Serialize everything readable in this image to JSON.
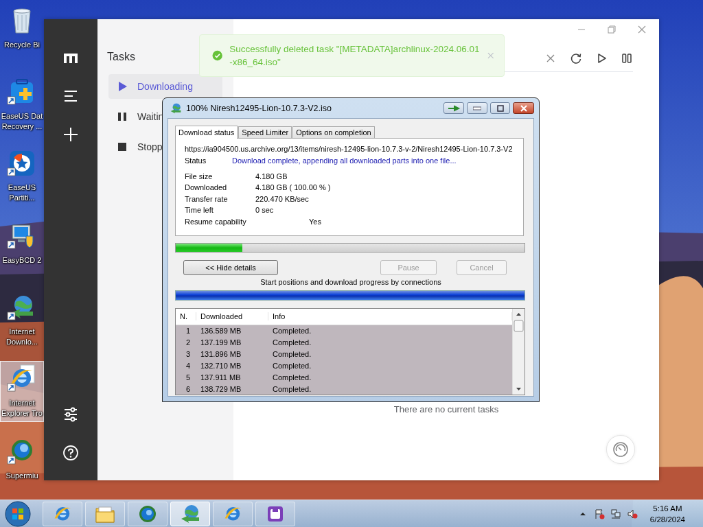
{
  "desktop": {
    "kind": "picture",
    "icons": [
      {
        "lines": [
          "Recycle Bi"
        ],
        "selected": false
      },
      {
        "lines": [
          "EaseUS Dat",
          "Recovery ..."
        ],
        "selected": false
      },
      {
        "lines": [
          "EaseUS",
          "Partiti..."
        ],
        "selected": false
      },
      {
        "lines": [
          "EasyBCD 2"
        ],
        "selected": false
      },
      {
        "lines": [
          "Internet",
          "Downlo..."
        ],
        "selected": false
      },
      {
        "lines": [
          "Internet",
          "Explorer Tro"
        ],
        "selected": true
      },
      {
        "lines": [
          "Supermiu"
        ],
        "selected": false
      }
    ]
  },
  "motrix": {
    "tasks_title": "Tasks",
    "task_lists": [
      {
        "label": "Downloading",
        "selected": true
      },
      {
        "label": "Waitin",
        "selected": false
      },
      {
        "label": "Stopp",
        "selected": false
      }
    ],
    "empty_message": "There are no current tasks",
    "toast": {
      "lines": [
        "Successfully deleted task \"[METADATA]archlinux-2024.06.01",
        "-x86_64.iso\""
      ]
    }
  },
  "download_dialog": {
    "title": "100% Niresh12495-Lion-10.7.3-V2.iso",
    "tabs": [
      {
        "label": "Download status",
        "selected": true
      },
      {
        "label": "Speed Limiter",
        "selected": false
      },
      {
        "label": "Options on completion",
        "selected": false
      }
    ],
    "url": "https://ia904500.us.archive.org/13/items/niresh-12495-lion-10.7.3-v-2/Niresh12495-Lion-10.7.3-V2",
    "status_label": "Status",
    "status_value": "Download complete, appending all downloaded parts into one file...",
    "fields": [
      {
        "label": "File size",
        "value": "4.180  GB",
        "kind": "plain"
      },
      {
        "label": "Downloaded",
        "value": "4.180  GB  ( 100.00 % )",
        "kind": "plain"
      },
      {
        "label": "Transfer rate",
        "value": "220.470  KB/sec",
        "kind": "plain"
      },
      {
        "label": "Time left",
        "value": "0 sec",
        "kind": "plain"
      },
      {
        "label": "Resume capability",
        "value": "Yes",
        "kind": "flag"
      }
    ],
    "progress": {
      "level": 0.19
    },
    "buttons": [
      {
        "label": "<< Hide details",
        "disabled": false
      },
      {
        "label": "Pause",
        "disabled": true
      },
      {
        "label": "Cancel",
        "disabled": true
      }
    ],
    "connections_caption": "Start positions and download progress by connections",
    "table": {
      "columns": [
        "N.",
        "Downloaded",
        "Info"
      ],
      "rows": [
        [
          "1",
          "136.589  MB",
          "Completed."
        ],
        [
          "2",
          "137.199  MB",
          "Completed."
        ],
        [
          "3",
          "131.896  MB",
          "Completed."
        ],
        [
          "4",
          "132.710  MB",
          "Completed."
        ],
        [
          "5",
          "137.911  MB",
          "Completed."
        ],
        [
          "6",
          "138.729  MB",
          "Completed."
        ]
      ]
    }
  },
  "taskbar": {
    "buttons": [
      {
        "selected": false
      },
      {
        "selected": false
      },
      {
        "selected": false
      },
      {
        "selected": true
      },
      {
        "selected": false
      },
      {
        "selected": false
      }
    ],
    "clock": {
      "time": "5:16 AM",
      "date": "6/28/2024"
    }
  }
}
